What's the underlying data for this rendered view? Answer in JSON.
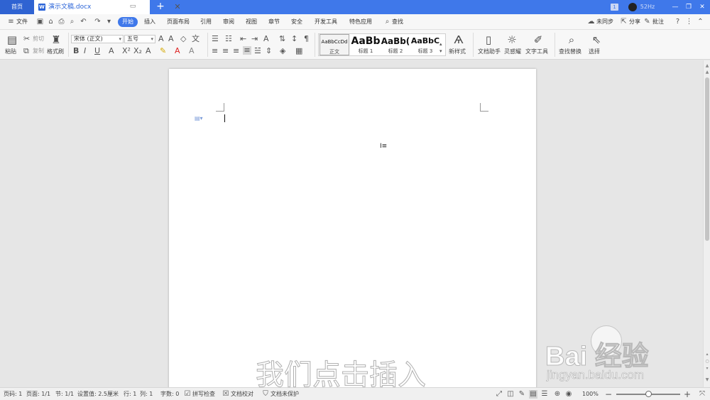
{
  "titlebar": {
    "home_tab": "首页",
    "doc_icon_letter": "W",
    "doc_name": "演示文稿.docx",
    "badge": "1",
    "refresh_rate": "52Hz"
  },
  "menubar": {
    "file": "文件",
    "tabs": [
      "开始",
      "插入",
      "页面布局",
      "引用",
      "审阅",
      "视图",
      "章节",
      "安全",
      "开发工具",
      "特色应用"
    ],
    "search": "查找",
    "sync": "未同步",
    "share": "分享",
    "comment": "批注"
  },
  "ribbon": {
    "paste": "粘贴",
    "cut": "剪切",
    "copy": "复制",
    "format_painter": "格式刷",
    "font_name": "宋体 (正文)",
    "font_size": "五号",
    "styles": [
      {
        "preview": "AaBbCcDd",
        "name": "正文"
      },
      {
        "preview": "AaBb",
        "name": "标题 1"
      },
      {
        "preview": "AaBb(",
        "name": "标题 2"
      },
      {
        "preview": "AaBbC",
        "name": "标题 3"
      }
    ],
    "new_style": "新样式",
    "doc_assistant": "文档助手",
    "inspiration": "灵感耀",
    "text_tools": "文字工具",
    "find_replace": "查找替换",
    "select": "选择"
  },
  "watermark": {
    "caption": "我们点击插入",
    "logo": "Bai  经验",
    "site": "jingyan.baidu.com"
  },
  "statusbar": {
    "page": "页码: 1",
    "pages": "页面: 1/1",
    "section": "节: 1/1",
    "setting": "设置值: 2.5厘米",
    "row": "行: 1",
    "col": "列: 1",
    "words": "字数: 0",
    "spell": "拼写检查",
    "proof": "文档校对",
    "protect": "文档未保护",
    "zoom": "100%",
    "zoom_level": 0.5
  }
}
